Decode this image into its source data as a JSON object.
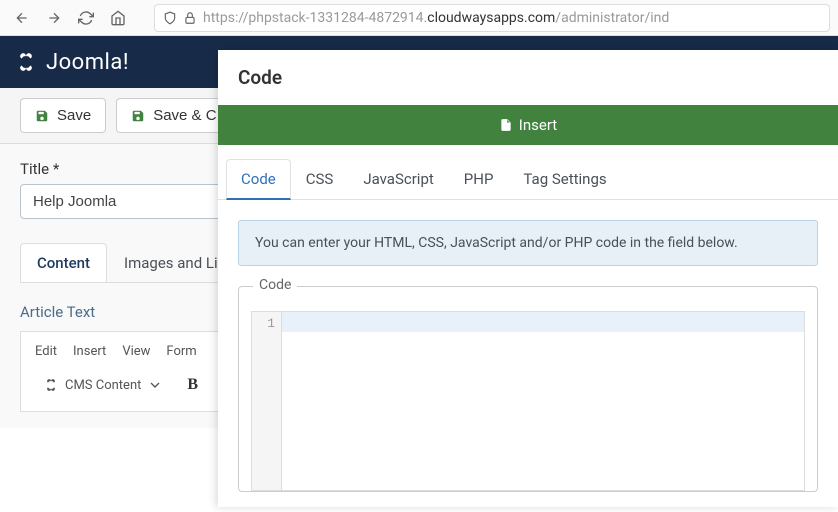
{
  "browser": {
    "url_prefix": "https://phpstack-1331284-4872914.",
    "url_domain": "cloudwaysapps.com",
    "url_suffix": "/administrator/ind"
  },
  "brand": "Joomla!",
  "toolbar": {
    "save_label": "Save",
    "save_close_label": "Save & C"
  },
  "title_field": {
    "label": "Title *",
    "value": "Help Joomla"
  },
  "content_tabs": {
    "content": "Content",
    "images": "Images and Link"
  },
  "article": {
    "label": "Article Text",
    "menu": [
      "Edit",
      "Insert",
      "View",
      "Form"
    ],
    "cms_label": "CMS Content"
  },
  "modal": {
    "title": "Code",
    "insert_label": "Insert",
    "tabs": [
      "Code",
      "CSS",
      "JavaScript",
      "PHP",
      "Tag Settings"
    ],
    "info_text": "You can enter your HTML, CSS, JavaScript and/or PHP code in the field below.",
    "fieldset_label": "Code",
    "line_number": "1"
  }
}
